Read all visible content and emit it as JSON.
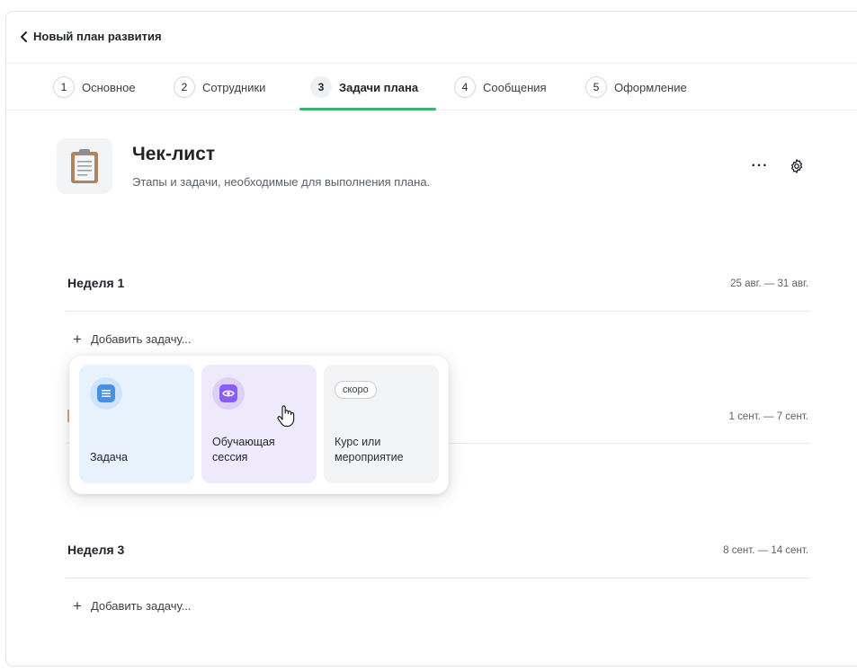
{
  "header": {
    "title": "Новый план развития"
  },
  "steps": [
    {
      "num": "1",
      "label": "Основное"
    },
    {
      "num": "2",
      "label": "Сотрудники"
    },
    {
      "num": "3",
      "label": "Задачи плана",
      "active": true
    },
    {
      "num": "4",
      "label": "Сообщения"
    },
    {
      "num": "5",
      "label": "Оформление"
    }
  ],
  "checklist": {
    "title": "Чек-лист",
    "subtitle": "Этапы и задачи, необходимые для выполнения плана.",
    "more_label": "···"
  },
  "weeks": [
    {
      "title": "Неделя 1",
      "date": "25 авг. — 31 авг.",
      "add_label": "Добавить задачу..."
    },
    {
      "title": "",
      "date": "1 сент. — 7 сент."
    },
    {
      "title": "Неделя 3",
      "date": "8 сент. — 14 сент.",
      "add_label": "Добавить задачу..."
    }
  ],
  "popup": {
    "task_label": "Задача",
    "session_label": "Обучающая сессия",
    "course_label": "Курс или мероприятие",
    "soon_badge": "скоро"
  },
  "icons": {
    "back": "chevron-left-icon",
    "more": "more-horizontal-icon",
    "settings": "gear-icon",
    "checklist": "clipboard-icon",
    "task": "list-icon",
    "session": "eye-icon",
    "cursor": "hand-pointer-icon"
  },
  "colors": {
    "active_step_underline": "#3cb371",
    "task_card_bg": "#e8f2fd",
    "session_card_bg": "#efeafb",
    "course_card_bg": "#f3f4f6"
  }
}
